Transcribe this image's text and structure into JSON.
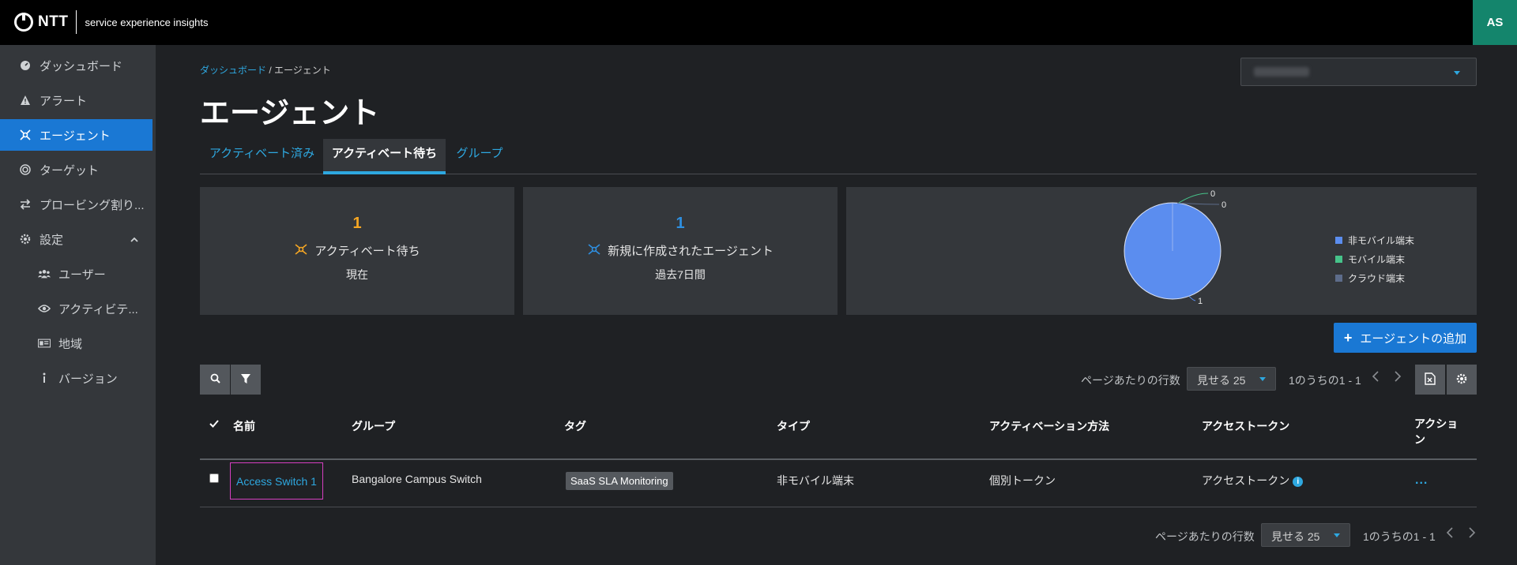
{
  "header": {
    "brand": "NTT",
    "subtitle": "service experience insights",
    "avatar": "AS"
  },
  "sidebar": {
    "items": [
      {
        "label": "ダッシュボード",
        "icon": "dashboard-icon"
      },
      {
        "label": "アラート",
        "icon": "alert-icon"
      },
      {
        "label": "エージェント",
        "icon": "agent-icon",
        "active": true
      },
      {
        "label": "ターゲット",
        "icon": "target-icon"
      },
      {
        "label": "プロービング割り...",
        "icon": "swap-icon"
      },
      {
        "label": "設定",
        "icon": "gear-icon",
        "expanded": true
      },
      {
        "label": "ユーザー",
        "icon": "users-icon"
      },
      {
        "label": "アクティビテ...",
        "icon": "eye-icon"
      },
      {
        "label": "地域",
        "icon": "region-icon"
      },
      {
        "label": "バージョン",
        "icon": "info-icon"
      }
    ]
  },
  "breadcrumb": {
    "parent": "ダッシュボード",
    "separator": "/",
    "current": "エージェント"
  },
  "page": {
    "title": "エージェント"
  },
  "tabs": [
    "アクティベート済み",
    "アクティベート待ち",
    "グループ"
  ],
  "cards": {
    "pending": {
      "value": "1",
      "label": "アクティベート待ち",
      "period": "現在",
      "color": "#f5a623"
    },
    "new": {
      "value": "1",
      "label": "新規に作成されたエージェント",
      "period": "過去7日間",
      "color": "#2e8fe0"
    }
  },
  "chart_data": {
    "type": "pie",
    "categories": [
      "非モバイル端末",
      "モバイル端末",
      "クラウド端末"
    ],
    "values": [
      1,
      0,
      0
    ],
    "colors": [
      "#5b8def",
      "#46c38a",
      "#5d6c8a"
    ],
    "legend_position": "right"
  },
  "add_button": "エージェントの追加",
  "pagination": {
    "rows_label": "ページあたりの行数",
    "rows_value": "見せる 25",
    "range": "1のうちの1 - 1"
  },
  "table": {
    "headers": [
      "名前",
      "グループ",
      "タグ",
      "タイプ",
      "アクティベーション方法",
      "アクセストークン",
      "アクション"
    ],
    "rows": [
      {
        "name": "Access Switch 1",
        "group": "Bangalore Campus Switch",
        "tag": "SaaS SLA Monitoring",
        "type": "非モバイル端末",
        "activation": "個別トークン",
        "token": "アクセストークン",
        "actions": "..."
      }
    ]
  }
}
